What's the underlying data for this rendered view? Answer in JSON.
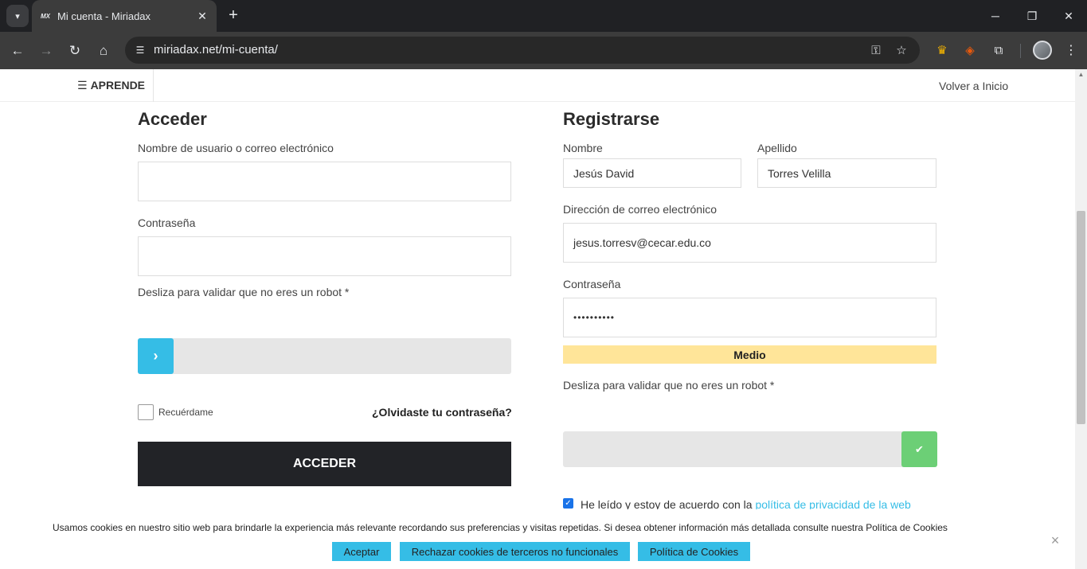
{
  "browser": {
    "tab_title": "Mi cuenta - Miriadax",
    "tab_favicon": "MX",
    "url_host": "miriadax.net",
    "url_path": "/mi-cuenta/"
  },
  "header": {
    "menu_label": "APRENDE",
    "back_home": "Volver a Inicio"
  },
  "login": {
    "title": "Acceder",
    "username_label": "Nombre de usuario o correo electrónico",
    "username_value": "",
    "password_label": "Contraseña",
    "password_value": "",
    "captcha_label": "Desliza para validar que no eres un robot *",
    "captcha_handle_icon": "›",
    "captcha_progress": 0,
    "remember_label": "Recuérdame",
    "remember_checked": false,
    "forgot_label": "¿Olvidaste tu contraseña?",
    "submit_label": "ACCEDER"
  },
  "register": {
    "title": "Registrarse",
    "first_name_label": "Nombre",
    "first_name_value": "Jesús David",
    "last_name_label": "Apellido",
    "last_name_value": "Torres Velilla",
    "email_label": "Dirección de correo electrónico",
    "email_value": "jesus.torresv@cecar.edu.co",
    "password_label": "Contraseña",
    "password_value": "••••••••••",
    "strength_label": "Medio",
    "captcha_label": "Desliza para validar que no eres un robot *",
    "captcha_handle_icon": "✔",
    "captcha_progress": 1,
    "privacy_text": "He leído y estoy de acuerdo con la ",
    "privacy_link": "política de privacidad de la web",
    "privacy_checked": true
  },
  "cookies": {
    "text": "Usamos cookies en nuestro sitio web para brindarle la experiencia más relevante recordando sus preferencias y visitas repetidas. Si desea obtener información más detallada consulte nuestra Política de Cookies",
    "accept": "Aceptar",
    "reject": "Rechazar cookies de terceros no funcionales",
    "policy": "Política de Cookies",
    "close": "×"
  },
  "colors": {
    "accent": "#35bde6",
    "success": "#6ccf76",
    "strength_medium": "#ffe599",
    "dark_button": "#222327"
  }
}
